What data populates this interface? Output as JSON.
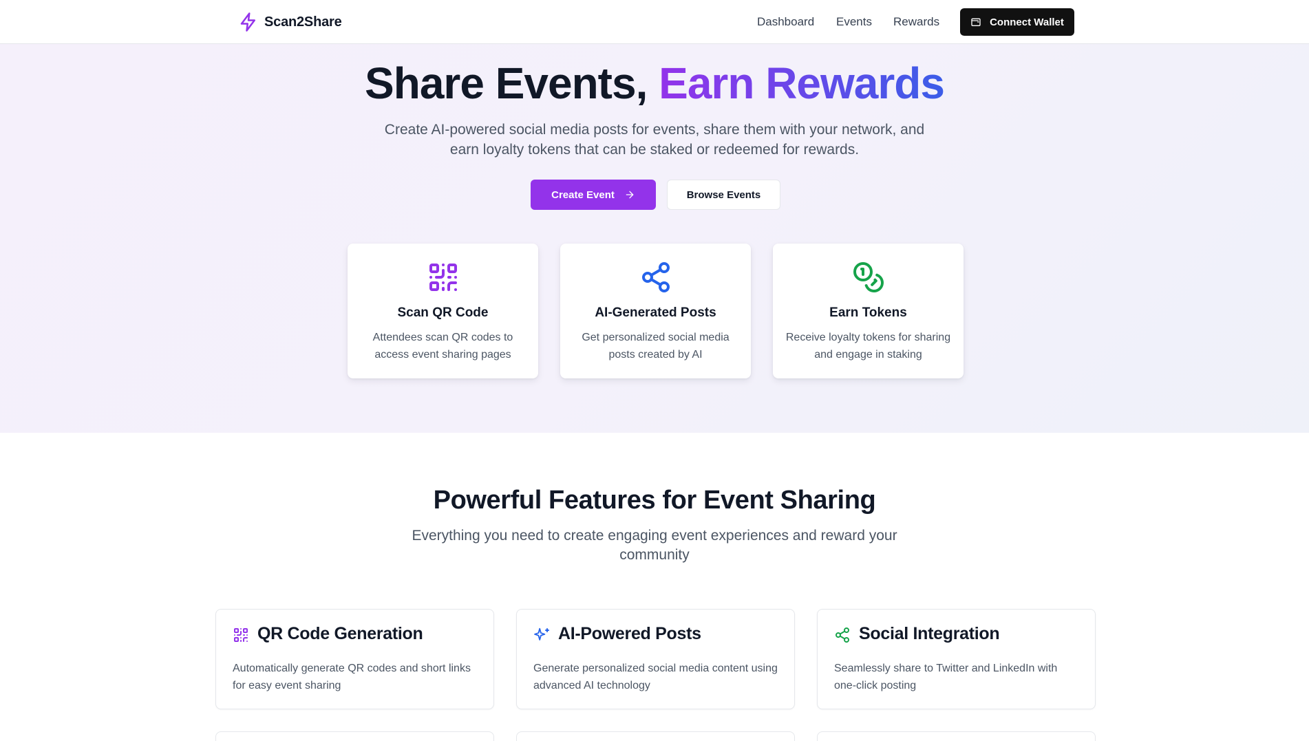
{
  "header": {
    "brand": "Scan2Share",
    "nav": [
      "Dashboard",
      "Events",
      "Rewards"
    ],
    "wallet_button": "Connect Wallet"
  },
  "hero": {
    "title_plain": "Share Events, ",
    "title_gradient": "Earn Rewards",
    "subtitle": "Create AI-powered social media posts for events, share them with your network, and earn loyalty tokens that can be staked or redeemed for rewards.",
    "primary_button": "Create Event",
    "secondary_button": "Browse Events",
    "steps": [
      {
        "icon": "qr-code-icon",
        "title": "Scan QR Code",
        "description": "Attendees scan QR codes to access event sharing pages",
        "color": "#9333ea"
      },
      {
        "icon": "share-icon",
        "title": "AI-Generated Posts",
        "description": "Get personalized social media posts created by AI",
        "color": "#2563eb"
      },
      {
        "icon": "coins-icon",
        "title": "Earn Tokens",
        "description": "Receive loyalty tokens for sharing and engage in staking",
        "color": "#16a34a"
      }
    ]
  },
  "features": {
    "title": "Powerful Features for Event Sharing",
    "subtitle": "Everything you need to create engaging event experiences and reward your community",
    "items": [
      {
        "icon": "qr-code-icon",
        "title": "QR Code Generation",
        "description": "Automatically generate QR codes and short links for easy event sharing",
        "color": "#9333ea"
      },
      {
        "icon": "sparkles-icon",
        "title": "AI-Powered Posts",
        "description": "Generate personalized social media content using advanced AI technology",
        "color": "#2563eb"
      },
      {
        "icon": "share-icon",
        "title": "Social Integration",
        "description": "Seamlessly share to Twitter and LinkedIn with one-click posting",
        "color": "#16a34a"
      }
    ]
  },
  "colors": {
    "accent_purple": "#9333ea",
    "accent_blue": "#2563eb",
    "accent_green": "#16a34a",
    "dark": "#111111"
  }
}
